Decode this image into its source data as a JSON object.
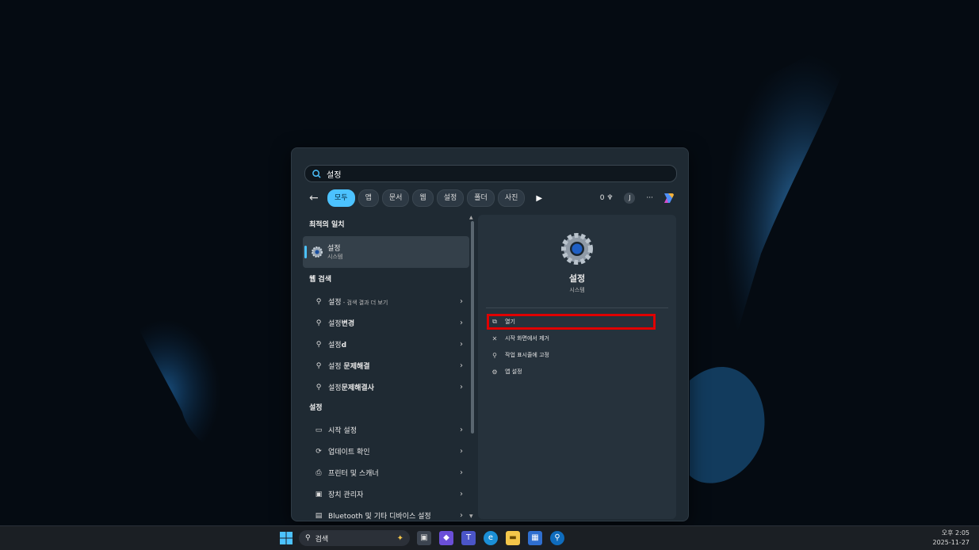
{
  "search": {
    "query": "설정"
  },
  "filters": {
    "tabs": [
      "모두",
      "앱",
      "문서",
      "웹",
      "설정",
      "폴더",
      "사진"
    ],
    "points": "0",
    "avatar": "J",
    "more": "···"
  },
  "left": {
    "best_match_title": "최적의 일치",
    "best_match": {
      "name": "설정",
      "type": "시스템"
    },
    "web_title": "웹 검색",
    "web_items": [
      {
        "prefix": "설정",
        "bold": "",
        "suffix": " - 검색 결과 더 보기"
      },
      {
        "prefix": "설정",
        "bold": "변경",
        "suffix": ""
      },
      {
        "prefix": "설정",
        "bold": "d",
        "suffix": ""
      },
      {
        "prefix": "설정 ",
        "bold": "문제해결",
        "suffix": ""
      },
      {
        "prefix": "설정",
        "bold": "문제해결사",
        "suffix": ""
      }
    ],
    "settings_title": "설정",
    "settings_items": [
      {
        "label": "시작 설정",
        "icon": "start-icon"
      },
      {
        "label": "업데이트 확인",
        "icon": "refresh-icon"
      },
      {
        "label": "프린터 및 스캐너",
        "icon": "printer-icon"
      },
      {
        "label": "장치 관리자",
        "icon": "device-manager-icon"
      },
      {
        "label": "Bluetooth 및 기타 디바이스 설정",
        "icon": "bluetooth-devices-icon"
      }
    ]
  },
  "right": {
    "app_name": "설정",
    "app_type": "시스템",
    "actions": [
      {
        "label": "열기",
        "icon": "open-external-icon"
      },
      {
        "label": "시작 화면에서 제거",
        "icon": "unpin-icon"
      },
      {
        "label": "작업 표시줄에 고정",
        "icon": "pin-icon"
      },
      {
        "label": "앱 설정",
        "icon": "gear-icon"
      }
    ]
  },
  "taskbar": {
    "search_placeholder": "검색",
    "time": "오후 2:05",
    "date": "2025-11-27"
  },
  "colors": {
    "accent": "#4cc2ff",
    "highlight": "#e00000"
  }
}
